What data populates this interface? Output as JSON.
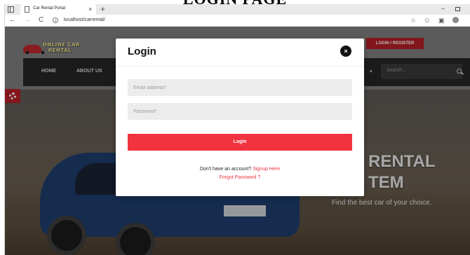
{
  "caption": "LOGIN PAGE",
  "browser": {
    "tab_title": "Car Rental Portal",
    "tab_close": "×",
    "new_tab": "+",
    "url": "localhost/carrental/",
    "back_glyph": "←",
    "forward_glyph": "→",
    "reload_glyph": "C",
    "minimize_glyph": "–",
    "icons": [
      "sidebar-icon",
      "page-icon",
      "info-icon",
      "favorite-icon",
      "collections-icon",
      "profile-icon"
    ]
  },
  "site": {
    "logo_lines": [
      "ONLINE CAR",
      "RENTAL"
    ],
    "login_register": "LOGIN / REGISTER",
    "nav": [
      "HOME",
      "ABOUT US"
    ],
    "search_placeholder": "Search...",
    "hero_title_lines": [
      "RENTAL",
      "TEM"
    ],
    "hero_subtitle": "Find the best car of your choice."
  },
  "modal": {
    "title": "Login",
    "close_glyph": "×",
    "email_placeholder": "Email address*",
    "password_placeholder": "Password*",
    "login_button": "Login",
    "signup_prompt": "Don't have an account?",
    "signup_link": "Signup Here",
    "forgot_link": "Forgot Password ?"
  },
  "colors": {
    "accent_red": "#f0333f",
    "header_red": "#b51f26",
    "navbar": "#262626"
  }
}
